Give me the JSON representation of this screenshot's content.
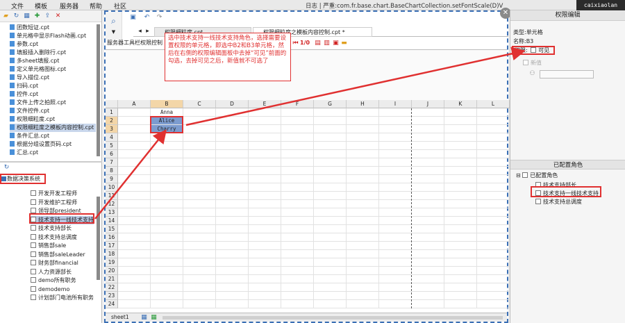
{
  "menu": {
    "file": "文件",
    "template": "模板",
    "server": "服务器",
    "help": "帮助",
    "community": "社区"
  },
  "log_text": "日志 | 严重:com.fr.base.chart.BaseChartCollection.setFontScale(D)V",
  "user": "caixiaolan",
  "file_tree": [
    "团数短证.cpt",
    "单元格中显示Flash动画.cpt",
    "参数.cpt",
    "填报插入删除行.cpt",
    "多sheet填报.cpt",
    "定义单元格图标.cpt",
    "导入描位.cpt",
    "扫码.cpt",
    "控件.cpt",
    "文件上传之拍照.cpt",
    "文件控件.cpt",
    "权限细粒度.cpt",
    "权限细粒度之模板内容控制.cpt",
    "条件汇总.cpt",
    "根据分组设置页码.cpt",
    "汇总.cpt"
  ],
  "system_root": "数据决策系统",
  "roles_left": [
    "开发开发工程师",
    "开发维护工程师",
    "领导部president",
    "技术支持一线技术支持",
    "技术支持部长",
    "技术支持总调度",
    "销售部sale",
    "销售部saleLeader",
    "财务部financial",
    "人力资源部长",
    "demo所有职务",
    "demodemo",
    "计划部门电池所有职务"
  ],
  "tabs": {
    "tab1": "权限细粒度.cpt",
    "tab2": "权限细粒度之模板内容控制.cpt *"
  },
  "toolbar_label": "服务器工具栏权限控制",
  "callout": "选中技术支持一线技术支持角色，选择需要设置权限的单元格，即选中B2和B3单元格，然后在右侧的权限编辑面板中去掉“可见”前面的勾选，去掉可见之后，新值就不可选了",
  "columns": [
    "A",
    "B",
    "C",
    "D",
    "E",
    "F",
    "G",
    "H",
    "I",
    "J",
    "K",
    "L"
  ],
  "rows": [
    "1",
    "2",
    "3",
    "4",
    "5",
    "6",
    "7",
    "8",
    "9",
    "10",
    "11",
    "12",
    "13",
    "14",
    "15",
    "16",
    "17",
    "18",
    "19",
    "20",
    "21",
    "22",
    "23",
    "24"
  ],
  "cells": {
    "b1": "Anna",
    "b2": "Alice",
    "b3": "Charry"
  },
  "sheet_tab": "sheet1",
  "right": {
    "title": "权限编辑",
    "type": "类型:单元格",
    "name": "名称:B3",
    "perm_label": "权限:",
    "visible": "可见",
    "new_value": "新值",
    "configured_title": "已配置角色",
    "configured_root": "已配置角色",
    "configured_roles": [
      "技术支持部长",
      "技术支持一线技术支持",
      "技术支持总调度"
    ]
  },
  "colors": {
    "accent": "#3a6fb5",
    "annotation": "#e03030",
    "selected_cell": "#7c9ccf"
  }
}
